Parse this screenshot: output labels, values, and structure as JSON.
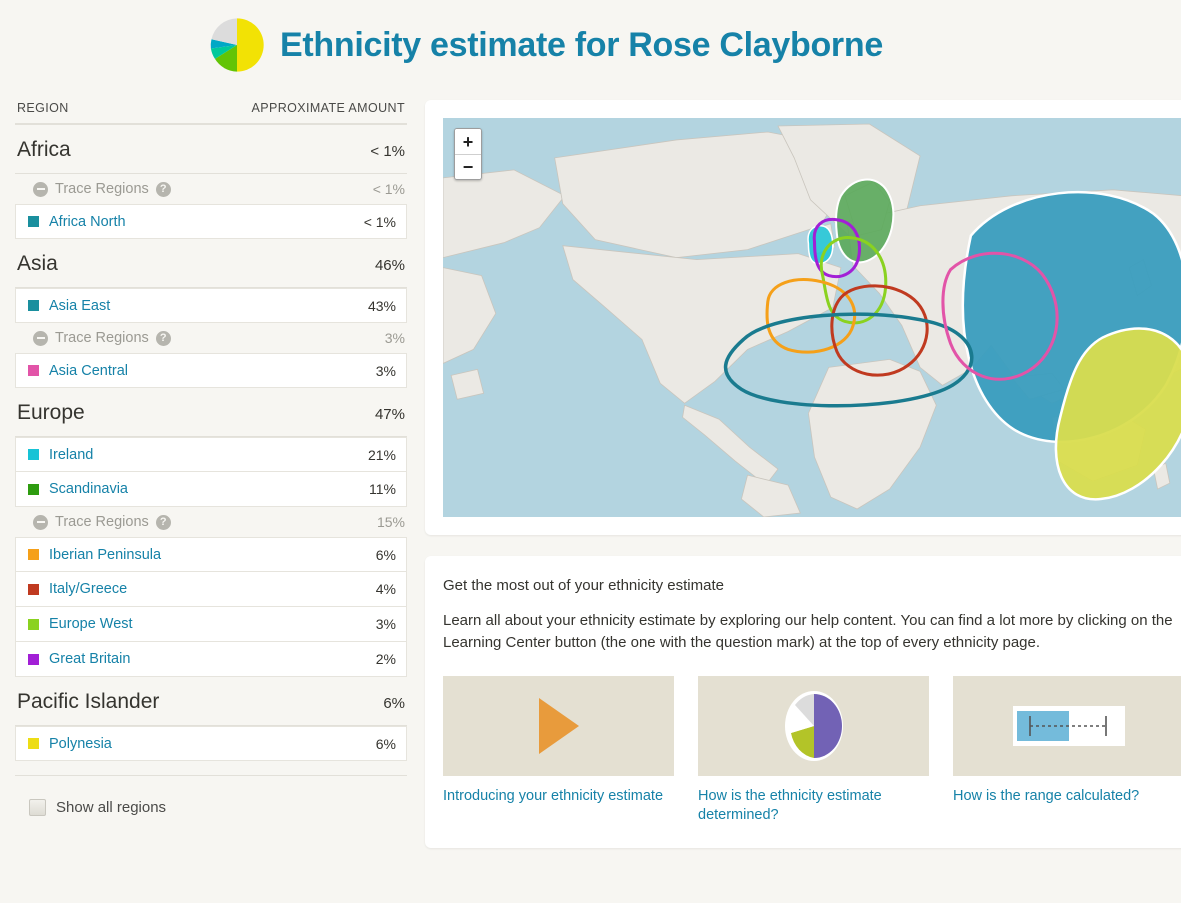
{
  "header": {
    "title": "Ethnicity estimate for Rose Clayborne",
    "pie_slices": [
      {
        "name": "yellow",
        "color": "#f2e205",
        "pct": 44
      },
      {
        "name": "green",
        "color": "#63c406",
        "pct": 20
      },
      {
        "name": "teal",
        "color": "#00c99b",
        "pct": 11
      },
      {
        "name": "cyan",
        "color": "#00a8c6",
        "pct": 5
      },
      {
        "name": "lightgray",
        "color": "#dcdcdc",
        "pct": 20
      }
    ]
  },
  "table": {
    "col_region": "REGION",
    "col_amount": "APPROXIMATE AMOUNT",
    "trace_label": "Trace Regions",
    "groups": [
      {
        "name": "Africa",
        "value": "< 1%",
        "trace": {
          "label": "Trace Regions",
          "value": "< 1%"
        },
        "rows": [
          {
            "name": "Africa North",
            "value": "< 1%",
            "color": "#1a8f9e"
          }
        ]
      },
      {
        "name": "Asia",
        "value": "46%",
        "pre_rows": [
          {
            "name": "Asia East",
            "value": "43%",
            "color": "#1a8f9e"
          }
        ],
        "trace": {
          "label": "Trace Regions",
          "value": "3%"
        },
        "rows": [
          {
            "name": "Asia Central",
            "value": "3%",
            "color": "#e254a8"
          }
        ]
      },
      {
        "name": "Europe",
        "value": "47%",
        "pre_rows": [
          {
            "name": "Ireland",
            "value": "21%",
            "color": "#17c3d6"
          },
          {
            "name": "Scandinavia",
            "value": "11%",
            "color": "#2e9c10"
          }
        ],
        "trace": {
          "label": "Trace Regions",
          "value": "15%"
        },
        "rows": [
          {
            "name": "Iberian Peninsula",
            "value": "6%",
            "color": "#f5a019"
          },
          {
            "name": "Italy/Greece",
            "value": "4%",
            "color": "#c03a20"
          },
          {
            "name": "Europe West",
            "value": "3%",
            "color": "#8ad220"
          },
          {
            "name": "Great Britain",
            "value": "2%",
            "color": "#a21fd6"
          }
        ]
      },
      {
        "name": "Pacific Islander",
        "value": "6%",
        "rows": [
          {
            "name": "Polynesia",
            "value": "6%",
            "color": "#eddd14"
          }
        ]
      }
    ],
    "show_all_label": "Show all regions"
  },
  "map": {
    "zoom_in": "+",
    "zoom_out": "−",
    "ocean_color": "#b3d4e0",
    "land_color": "#ebe9e4",
    "overlays": [
      {
        "name": "Asia East",
        "color": "#3a9dbe",
        "style": "fill"
      },
      {
        "name": "Polynesia",
        "color": "#d9dd4e",
        "style": "fill"
      },
      {
        "name": "Scandinavia",
        "color": "#5aa85a",
        "style": "fill"
      },
      {
        "name": "Ireland",
        "color": "#17c3d6",
        "style": "fill"
      },
      {
        "name": "Great Britain",
        "color": "#a21fd6",
        "style": "outline"
      },
      {
        "name": "Europe West",
        "color": "#8ad220",
        "style": "outline"
      },
      {
        "name": "Iberian Peninsula",
        "color": "#f5a019",
        "style": "outline"
      },
      {
        "name": "Italy/Greece",
        "color": "#c03a20",
        "style": "outline"
      },
      {
        "name": "Africa North",
        "color": "#1a7b8f",
        "style": "outline"
      },
      {
        "name": "Asia Central",
        "color": "#e254a8",
        "style": "outline"
      }
    ]
  },
  "help": {
    "title": "Get the most out of your ethnicity estimate",
    "body": "Learn all about your ethnicity estimate by exploring our help content. You can find a lot more by clicking on the Learning Center button (the one with the question mark) at the top of every ethnicity page.",
    "cards": [
      {
        "caption": "Introducing your ethnicity estimate",
        "icon": "play-icon"
      },
      {
        "caption": "How is the ethnicity estimate determined?",
        "icon": "pie-chart-icon"
      },
      {
        "caption": "How is the range calculated?",
        "icon": "range-bar-icon"
      }
    ]
  }
}
